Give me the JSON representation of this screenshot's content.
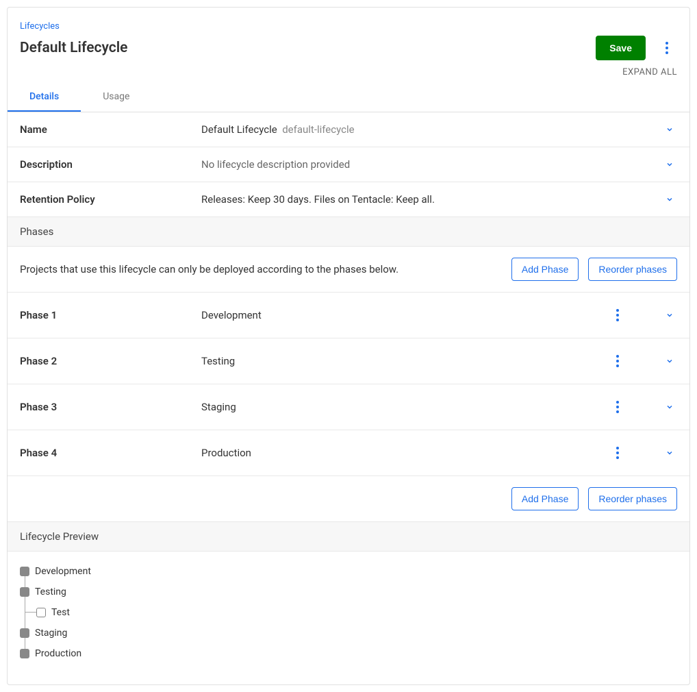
{
  "breadcrumb": "Lifecycles",
  "title": "Default Lifecycle",
  "actions": {
    "save": "Save",
    "expand_all": "EXPAND ALL"
  },
  "tabs": {
    "details": "Details",
    "usage": "Usage"
  },
  "fields": {
    "name": {
      "label": "Name",
      "value": "Default Lifecycle",
      "slug": "default-lifecycle"
    },
    "description": {
      "label": "Description",
      "value": "No lifecycle description provided"
    },
    "retention": {
      "label": "Retention Policy",
      "value": "Releases: Keep 30 days. Files on Tentacle: Keep all."
    }
  },
  "phases_section": {
    "header": "Phases",
    "intro": "Projects that use this lifecycle can only be deployed according to the phases below.",
    "add_phase": "Add Phase",
    "reorder": "Reorder phases"
  },
  "phases": [
    {
      "label": "Phase 1",
      "name": "Development"
    },
    {
      "label": "Phase 2",
      "name": "Testing"
    },
    {
      "label": "Phase 3",
      "name": "Staging"
    },
    {
      "label": "Phase 4",
      "name": "Production"
    }
  ],
  "preview_section": {
    "header": "Lifecycle Preview"
  },
  "preview": {
    "development": "Development",
    "testing": "Testing",
    "test": "Test",
    "staging": "Staging",
    "production": "Production"
  }
}
